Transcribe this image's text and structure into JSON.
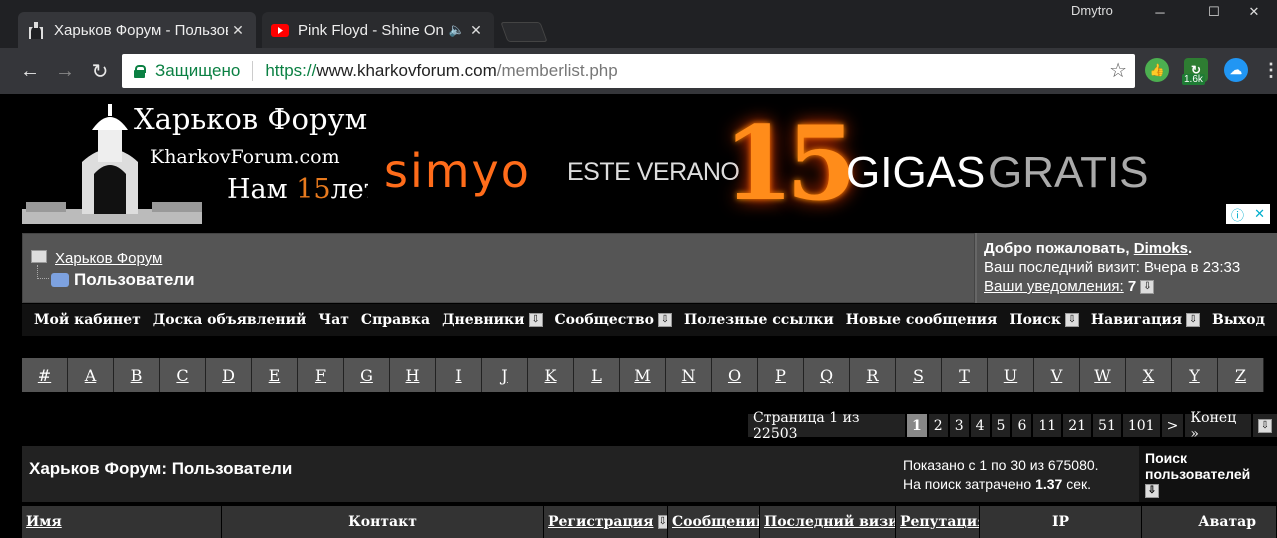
{
  "browser": {
    "user": "Dmytro",
    "tabs": [
      {
        "title": "Харьков Форум - Пользователи",
        "active": true
      },
      {
        "title": "Pink Floyd - Shine On You Crazy Diamond",
        "active": false,
        "audio": true
      }
    ],
    "omnibox": {
      "secure_label": "Защищено",
      "scheme": "https://",
      "host": "www.kharkovforum.com",
      "path": "/memberlist.php"
    },
    "extension_badge": "1.6k",
    "colors": {
      "titlebar": "#202124",
      "toolbar": "#35363a",
      "secure": "#0b8043"
    }
  },
  "logo": {
    "line1": "Харьков Форум",
    "line2": "KharkovForum.com",
    "line3_prefix": "Нам ",
    "line3_number": "15",
    "line3_suffix": "лет!"
  },
  "ad": {
    "brand": "simyo",
    "text1": "ESTE VERANO",
    "number": "15",
    "text2": "GIGAS",
    "text3": "GRATIS"
  },
  "breadcrumb": {
    "root": "Харьков Форум",
    "current": "Пользователи"
  },
  "welcome": {
    "greeting": "Добро пожаловать, ",
    "username": "Dimoks",
    "greeting_end": ".",
    "last_visit": "Ваш последний визит: Вчера в 23:33",
    "notifications_label": "Ваши уведомления:",
    "notifications_count": "7"
  },
  "menu": [
    {
      "label": "Мой кабинет",
      "dropdown": false
    },
    {
      "label": "Доска объявлений",
      "dropdown": false
    },
    {
      "label": "Чат",
      "dropdown": false
    },
    {
      "label": "Справка",
      "dropdown": false
    },
    {
      "label": "Дневники",
      "dropdown": true
    },
    {
      "label": "Сообщество",
      "dropdown": true
    },
    {
      "label": "Полезные ссылки",
      "dropdown": false
    },
    {
      "label": "Новые сообщения",
      "dropdown": false
    },
    {
      "label": "Поиск",
      "dropdown": true
    },
    {
      "label": "Навигация",
      "dropdown": true
    },
    {
      "label": "Выход",
      "dropdown": false
    }
  ],
  "letters": [
    "#",
    "A",
    "B",
    "C",
    "D",
    "E",
    "F",
    "G",
    "H",
    "I",
    "J",
    "K",
    "L",
    "M",
    "N",
    "O",
    "P",
    "Q",
    "R",
    "S",
    "T",
    "U",
    "V",
    "W",
    "X",
    "Y",
    "Z"
  ],
  "pagination": {
    "info": "Страница 1 из 22503",
    "pages": [
      "1",
      "2",
      "3",
      "4",
      "5",
      "6",
      "11",
      "21",
      "51",
      "101",
      ">",
      "Конец »"
    ],
    "current": "1"
  },
  "list": {
    "title": "Харьков Форум: Пользователи",
    "shown": "Показано с 1 по 30 из 675080.",
    "search_time_prefix": "На поиск затрачено ",
    "search_time": "1.37",
    "search_time_suffix": " сек.",
    "search_users": "Поиск пользователей"
  },
  "columns": [
    {
      "label": "Имя",
      "link": true,
      "align": "left",
      "sort": false
    },
    {
      "label": "Контакт",
      "link": false,
      "align": "center",
      "sort": false
    },
    {
      "label": "Регистрация",
      "link": true,
      "align": "left",
      "sort": true
    },
    {
      "label": "Сообщений",
      "link": true,
      "align": "left",
      "sort": false
    },
    {
      "label": "Последний визит",
      "link": true,
      "align": "left",
      "sort": false
    },
    {
      "label": "Репутация",
      "link": true,
      "align": "left",
      "sort": false
    },
    {
      "label": "IP",
      "link": false,
      "align": "center",
      "sort": false
    },
    {
      "label": "Аватар",
      "link": false,
      "align": "right",
      "sort": false
    }
  ]
}
